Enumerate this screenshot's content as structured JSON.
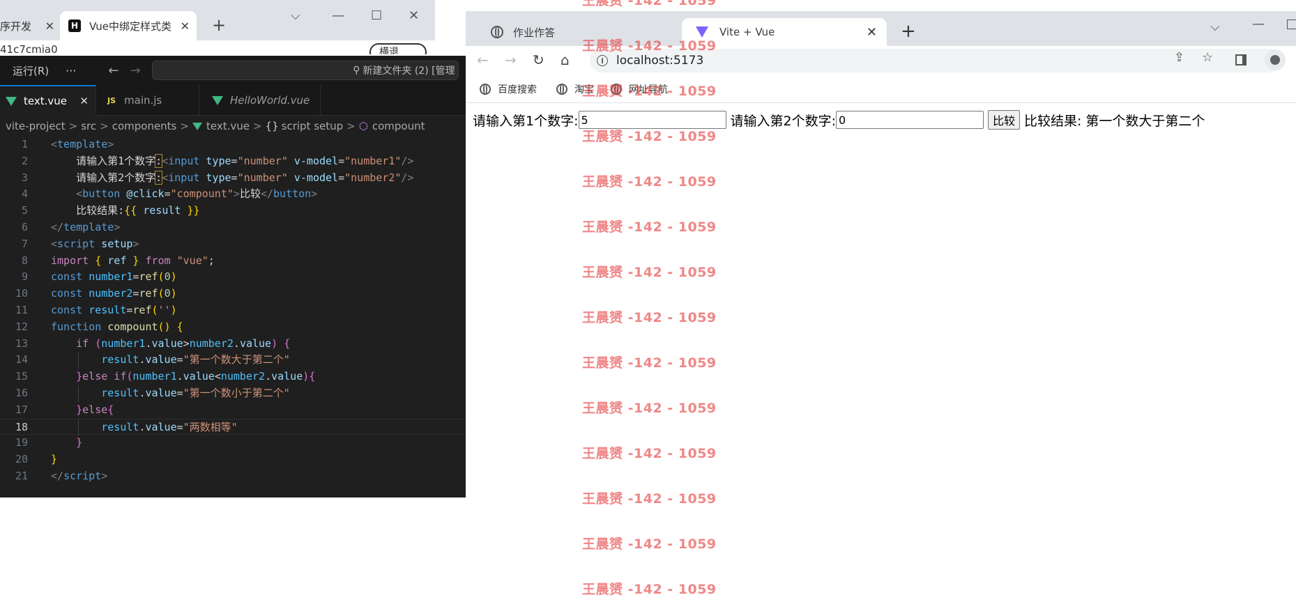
{
  "bg_browser": {
    "tab_partial": "序开发",
    "tab_active": "Vue中绑定样式类",
    "favicon_letter": "H",
    "url_partial": "41c7cmia0",
    "exit_button": "横退"
  },
  "vscode": {
    "menu_run": "运行(R)",
    "menu_more": "···",
    "search_text": "新建文件夹 (2) [管理",
    "tabs": [
      {
        "label": "text.vue"
      },
      {
        "label": "main.js"
      },
      {
        "label": "HelloWorld.vue"
      }
    ],
    "breadcrumb": {
      "p1": "vite-project",
      "p2": "src",
      "p3": "components",
      "p4": "text.vue",
      "p5": "script setup",
      "p6": "compount"
    },
    "current_line": 18
  },
  "browser": {
    "tabs": [
      {
        "label": "作业作答"
      },
      {
        "label": "Vite + Vue"
      }
    ],
    "url": "localhost:5173",
    "bookmarks": [
      "百度搜索",
      "淘宝",
      "网址导航"
    ]
  },
  "page": {
    "label1": "请输入第1个数字:",
    "value1": "5",
    "label2": "请输入第2个数字:",
    "value2": "0",
    "button": "比较",
    "result_label": "比较结果:",
    "result_value": "第一个数大于第二个"
  },
  "watermark": {
    "text": "王晨赟 -142 - 1059",
    "color": "#e53e3e"
  }
}
